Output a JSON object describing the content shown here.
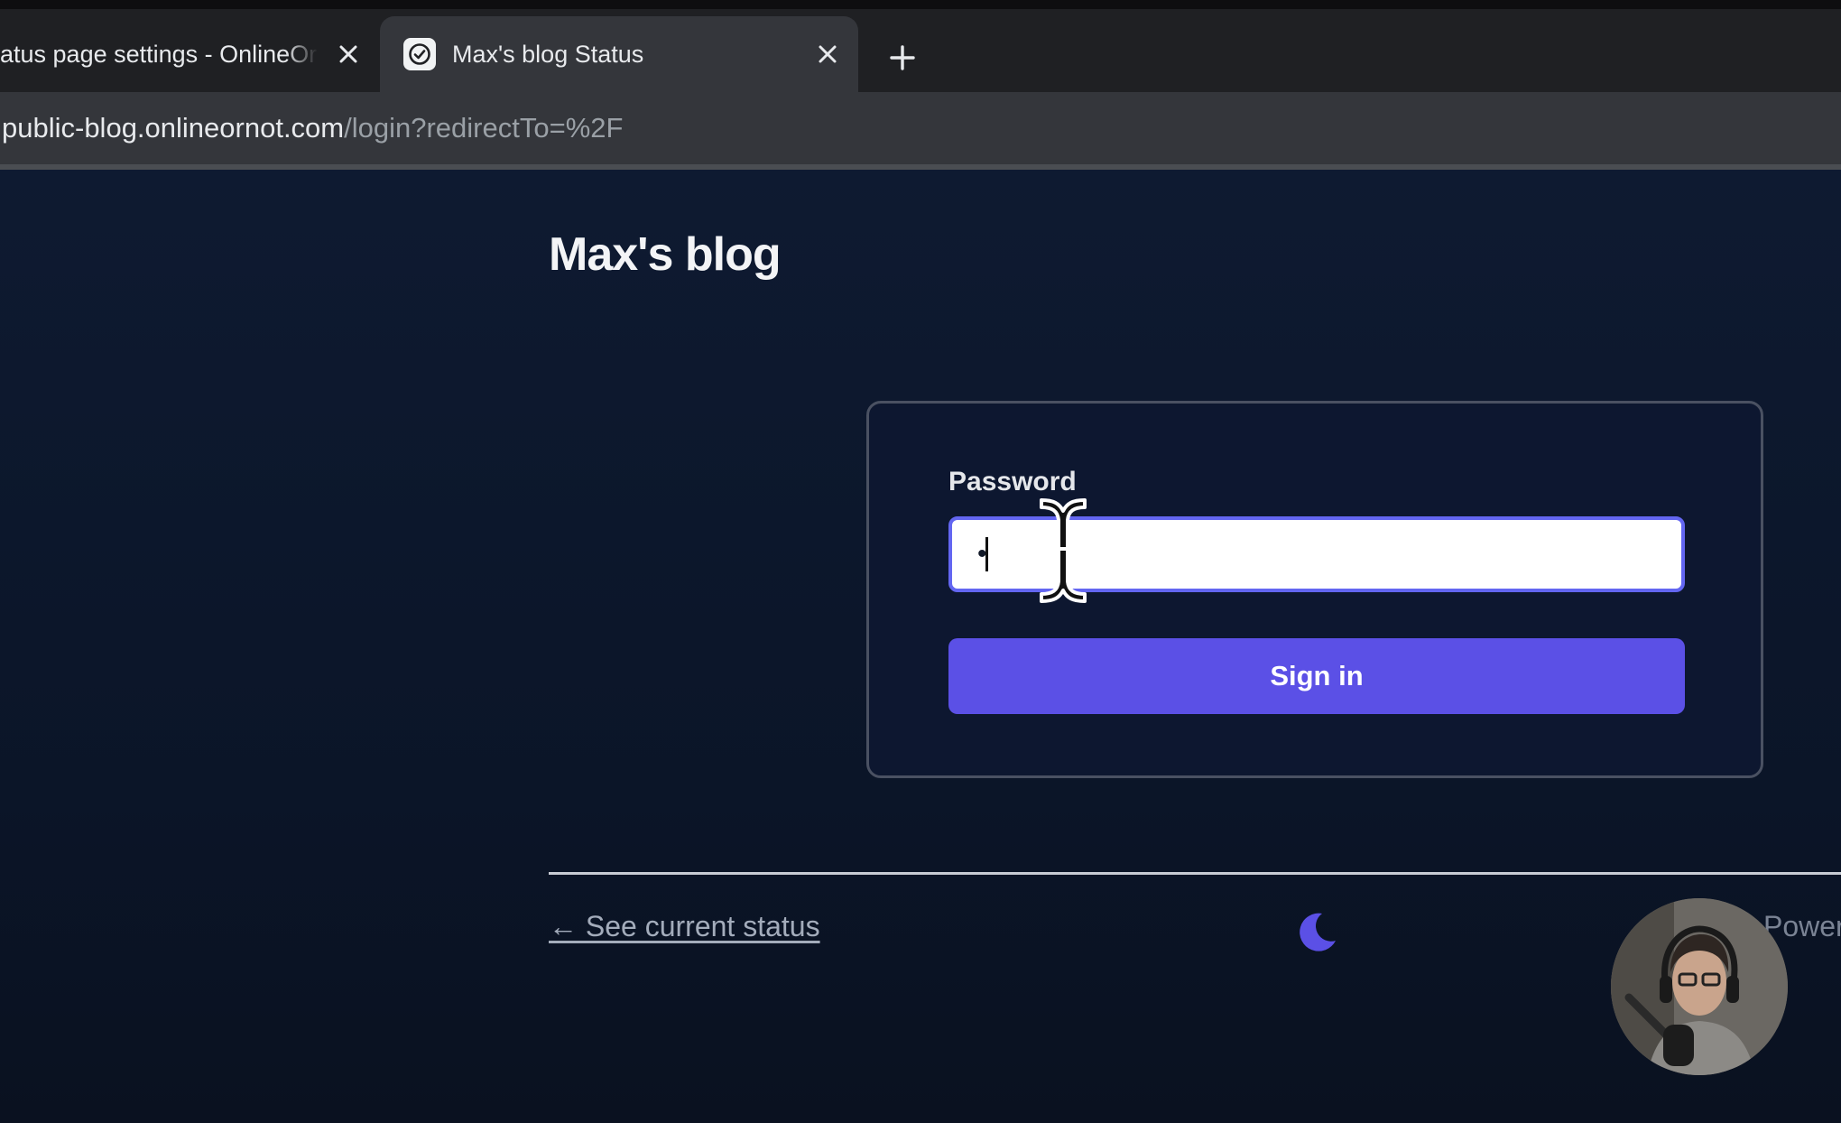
{
  "browser": {
    "tabs": [
      {
        "title": "atus page settings - OnlineOrNot",
        "active": false
      },
      {
        "title": "Max's blog Status",
        "active": true
      }
    ],
    "address": {
      "host": "public-blog.onlineornot.com",
      "path": "/login?redirectTo=%2F"
    }
  },
  "page": {
    "site_title": "Max's blog",
    "form": {
      "password_label": "Password",
      "password_value": "•",
      "signin_label": "Sign in"
    },
    "footer": {
      "status_link": "← See current status",
      "powered_by": "Powered by OnlineOrNot"
    }
  },
  "colors": {
    "page_bg": "#0b1528",
    "accent": "#5b50e6",
    "input_focus": "#6366f1",
    "moon": "#5b50e6"
  },
  "icons": {
    "favicon": "checkmark-circle-icon",
    "theme_toggle": "moon-icon",
    "cursor": "text-cursor-icon"
  }
}
